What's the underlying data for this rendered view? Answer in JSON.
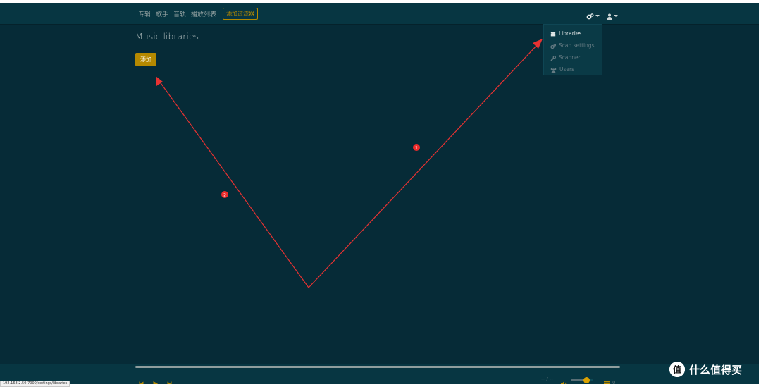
{
  "nav": {
    "links": [
      "专辑",
      "歌手",
      "音轨",
      "播放列表"
    ],
    "filter_button": "添加过滤器",
    "icons": [
      "cogs-icon",
      "user-icon"
    ]
  },
  "dropdown": {
    "items": [
      {
        "label": "Libraries",
        "icon": "database-icon",
        "active": true
      },
      {
        "label": "Scan settings",
        "icon": "cogs-icon",
        "active": false
      },
      {
        "label": "Scanner",
        "icon": "wrench-icon",
        "active": false
      },
      {
        "label": "Users",
        "icon": "users-icon",
        "active": false
      }
    ]
  },
  "page": {
    "title": "Music libraries",
    "add_button": "添加"
  },
  "annotations": {
    "marker_1": "1",
    "marker_2": "2"
  },
  "player": {
    "time": "-- / --",
    "queue_count": "0",
    "progress": 0,
    "volume": 0.7
  },
  "status_bar": {
    "url": "192.168.2.50:7000/settings/libraries"
  },
  "watermark": {
    "text": "什么值得买",
    "badge": "值"
  },
  "colors": {
    "background": "#062b37",
    "navbar": "#073642",
    "accent": "#b58900",
    "annotation": "#e83232"
  }
}
